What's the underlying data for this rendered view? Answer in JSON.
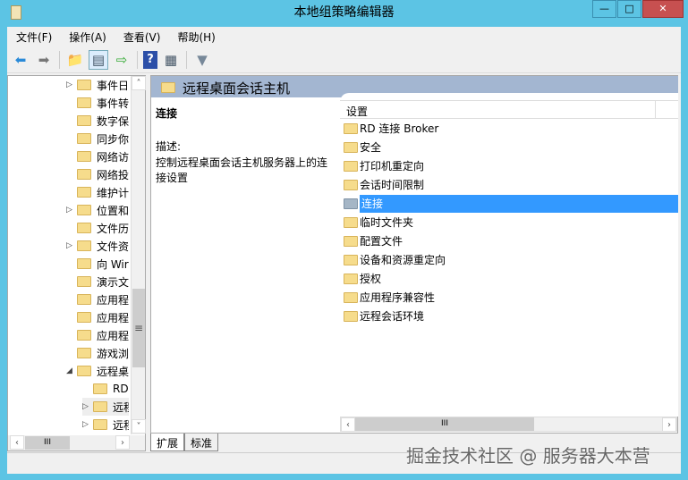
{
  "window": {
    "title": "本地组策略编辑器",
    "minimize": "—",
    "maximize": "□",
    "close": "✕"
  },
  "menu": [
    "文件(F)",
    "操作(A)",
    "查看(V)",
    "帮助(H)"
  ],
  "tree": [
    {
      "label": "事件日",
      "exp": "▷"
    },
    {
      "label": "事件转",
      "exp": ""
    },
    {
      "label": "数字保",
      "exp": ""
    },
    {
      "label": "同步你",
      "exp": ""
    },
    {
      "label": "网络访",
      "exp": ""
    },
    {
      "label": "网络投",
      "exp": ""
    },
    {
      "label": "维护计",
      "exp": ""
    },
    {
      "label": "位置和",
      "exp": "▷"
    },
    {
      "label": "文件历",
      "exp": ""
    },
    {
      "label": "文件资",
      "exp": "▷"
    },
    {
      "label": "向 Wir",
      "exp": ""
    },
    {
      "label": "演示文",
      "exp": ""
    },
    {
      "label": "应用程",
      "exp": ""
    },
    {
      "label": "应用程",
      "exp": ""
    },
    {
      "label": "应用程",
      "exp": ""
    },
    {
      "label": "游戏浏",
      "exp": ""
    },
    {
      "label": "远程桌",
      "exp": "◢"
    },
    {
      "label": "RD",
      "exp": "",
      "indent": 1
    },
    {
      "label": "远程",
      "exp": "▷",
      "indent": 1
    },
    {
      "label": "远程",
      "exp": "▷",
      "indent": 1
    }
  ],
  "pane": {
    "title": "远程桌面会话主机",
    "selected_name": "连接",
    "desc_label": "描述:",
    "desc_text": "控制远程桌面会话主机服务器上的连接设置",
    "column": "设置"
  },
  "items": [
    "RD 连接 Broker",
    "安全",
    "打印机重定向",
    "会话时间限制",
    "连接",
    "临时文件夹",
    "配置文件",
    "设备和资源重定向",
    "授权",
    "应用程序兼容性",
    "远程会话环境"
  ],
  "selected_index": 4,
  "tabs": [
    "扩展",
    "标准"
  ],
  "watermark": "掘金技术社区 @ 服务器大本营"
}
